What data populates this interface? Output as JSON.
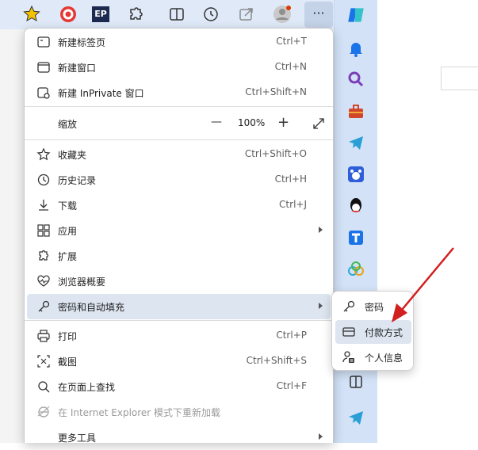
{
  "colors": {
    "accent": "#0f6cbd",
    "menu_hover": "#dde5f0",
    "annotation_arrow": "#d21f1f",
    "sidebar": "#d3e2f7",
    "toolbar": "#dfe9f8"
  },
  "toolbar": {
    "icons": [
      "extension-star-icon",
      "target-icon",
      "ep-icon",
      "extensions-puzzle-icon",
      "split-screen-icon",
      "history-icon",
      "share-icon",
      "profile-icon",
      "more-options-icon",
      "copilot-icon"
    ],
    "more_label": "···",
    "ep_label": "EP"
  },
  "menu": {
    "new_tab": {
      "label": "新建标签页",
      "shortcut": "Ctrl+T"
    },
    "new_window": {
      "label": "新建窗口",
      "shortcut": "Ctrl+N"
    },
    "new_inprivate": {
      "label": "新建 InPrivate 窗口",
      "shortcut": "Ctrl+Shift+N"
    },
    "zoom": {
      "label": "缩放",
      "minus": "—",
      "value": "100%",
      "plus": "+"
    },
    "favorites": {
      "label": "收藏夹",
      "shortcut": "Ctrl+Shift+O"
    },
    "history": {
      "label": "历史记录",
      "shortcut": "Ctrl+H"
    },
    "downloads": {
      "label": "下载",
      "shortcut": "Ctrl+J"
    },
    "apps": {
      "label": "应用"
    },
    "extensions": {
      "label": "扩展"
    },
    "browser_essentials": {
      "label": "浏览器概要"
    },
    "passwords_autofill": {
      "label": "密码和自动填充"
    },
    "print": {
      "label": "打印",
      "shortcut": "Ctrl+P"
    },
    "screenshot": {
      "label": "截图",
      "shortcut": "Ctrl+Shift+S"
    },
    "find": {
      "label": "在页面上查找",
      "shortcut": "Ctrl+F"
    },
    "ie_mode": {
      "label": "在 Internet Explorer 模式下重新加载"
    },
    "more_tools": {
      "label": "更多工具"
    }
  },
  "submenu": {
    "passwords": {
      "label": "密码"
    },
    "payment": {
      "label": "付款方式"
    },
    "personal_info": {
      "label": "个人信息"
    }
  },
  "sidebar": {
    "icons": [
      "bell-icon",
      "search-icon",
      "toolbox-icon",
      "telegram-icon",
      "baidu-icon",
      "qq-icon",
      "t-app-icon",
      "cloud-app-icon",
      "sidebar-layout-icon",
      "send-icon"
    ]
  }
}
